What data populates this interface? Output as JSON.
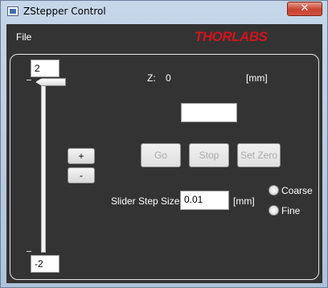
{
  "window": {
    "title": "ZStepper Control",
    "close_glyph": "✕"
  },
  "menu": {
    "file": "File"
  },
  "brand": {
    "logo_text": "THORLABS",
    "logo_color": "#d0141e"
  },
  "slider": {
    "max_value": "2",
    "min_value": "-2"
  },
  "position": {
    "label": "Z:",
    "value": "0",
    "unit": "[mm]"
  },
  "target_input": {
    "value": ""
  },
  "buttons": {
    "go": "Go",
    "stop": "Stop",
    "set_zero": "Set Zero",
    "increment": "+",
    "decrement": "-"
  },
  "step_size": {
    "label": "Slider Step Size",
    "value": "0.01",
    "unit": "[mm]"
  },
  "mode": {
    "coarse": "Coarse",
    "fine": "Fine"
  }
}
